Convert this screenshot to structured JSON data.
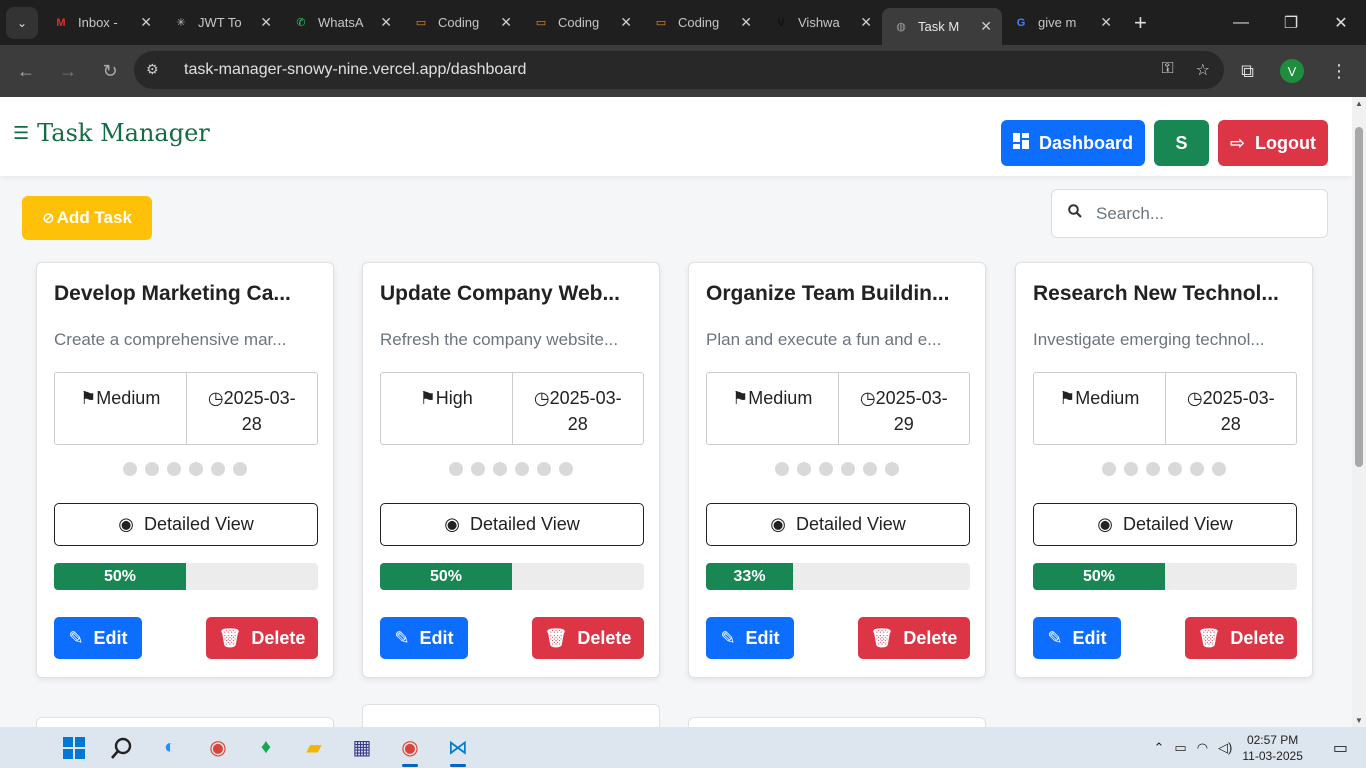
{
  "browser": {
    "tabs": [
      {
        "title": "Inbox -",
        "icon": "gmail-icon",
        "color": "#d93025",
        "glyph": "M",
        "active": false
      },
      {
        "title": "JWT To",
        "icon": "jwt-icon",
        "color": "#bbbbbb",
        "glyph": "✳",
        "active": false
      },
      {
        "title": "WhatsA",
        "icon": "whatsapp-icon",
        "color": "#25d366",
        "glyph": "✆",
        "active": false
      },
      {
        "title": "Coding",
        "icon": "coding-icon",
        "color": "#f28b20",
        "glyph": "▭",
        "active": false
      },
      {
        "title": "Coding",
        "icon": "coding-icon",
        "color": "#f28b20",
        "glyph": "▭",
        "active": false
      },
      {
        "title": "Coding",
        "icon": "coding-icon",
        "color": "#f28b20",
        "glyph": "▭",
        "active": false
      },
      {
        "title": "Vishwa",
        "icon": "v-logo-icon",
        "color": "#111111",
        "glyph": "V",
        "active": false
      },
      {
        "title": "Task M",
        "icon": "globe-icon",
        "color": "#9e9e9e",
        "glyph": "◍",
        "active": true
      },
      {
        "title": "give m",
        "icon": "google-icon",
        "color": "#4285f4",
        "glyph": "G",
        "active": false
      }
    ],
    "url": "task-manager-snowy-nine.vercel.app/dashboard",
    "profile_initial": "V"
  },
  "header": {
    "brand": "Task Manager",
    "dashboard_label": "Dashboard",
    "user_initial": "S",
    "logout_label": "Logout"
  },
  "toolbar": {
    "add_task_label": "Add Task",
    "search_placeholder": "Search..."
  },
  "tasks": [
    {
      "title": "Develop Marketing Ca...",
      "description": "Create a comprehensive mar...",
      "priority": "Medium",
      "date_line1": "2025-03-",
      "date_line2": "28",
      "progress_label": "50%",
      "progress": 0.5
    },
    {
      "title": "Update Company Web...",
      "description": "Refresh the company website...",
      "priority": "High",
      "date_line1": "2025-03-",
      "date_line2": "28",
      "progress_label": "50%",
      "progress": 0.5
    },
    {
      "title": "Organize Team Buildin...",
      "description": "Plan and execute a fun and e...",
      "priority": "Medium",
      "date_line1": "2025-03-",
      "date_line2": "29",
      "progress_label": "33%",
      "progress": 0.33
    },
    {
      "title": "Research New Technol...",
      "description": "Investigate emerging technol...",
      "priority": "Medium",
      "date_line1": "2025-03-",
      "date_line2": "28",
      "progress_label": "50%",
      "progress": 0.5
    }
  ],
  "card_actions": {
    "detail_label": "Detailed View",
    "edit_label": "Edit",
    "delete_label": "Delete"
  },
  "taskbar": {
    "time": "02:57 PM",
    "date": "11-03-2025"
  },
  "colors": {
    "primary": "#0d6efd",
    "success": "#198754",
    "danger": "#dc3545",
    "warning": "#ffc107",
    "brand": "#146c43"
  }
}
